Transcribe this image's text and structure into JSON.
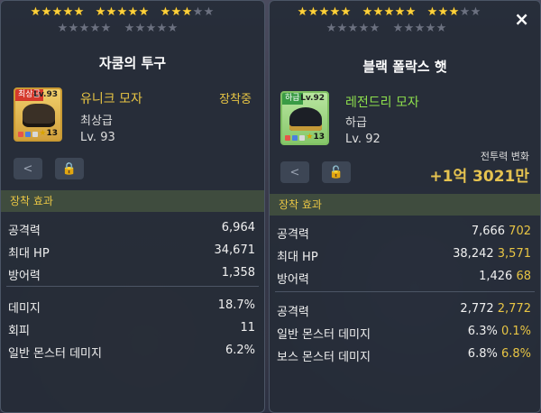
{
  "left": {
    "stars": {
      "on": 13,
      "total": 15
    },
    "title": "자쿰의 투구",
    "item": {
      "grade_tag": "최상급",
      "level_tag": "Lv.93",
      "star_count": "13",
      "name": "유니크 모자",
      "equipped": "장착중",
      "grade": "최상급",
      "level": "Lv. 93",
      "dot_colors": [
        "#e6554a",
        "#4a7fe0",
        "#d9d9d9"
      ]
    },
    "section_label": "장착 효과",
    "stats": [
      {
        "key": "공격력",
        "value": "6,964"
      },
      {
        "key": "최대 HP",
        "value": "34,671"
      },
      {
        "key": "방어력",
        "value": "1,358"
      }
    ],
    "stats2": [
      {
        "key": "데미지",
        "value": "18.7%"
      },
      {
        "key": "회피",
        "value": "11"
      },
      {
        "key": "일반 몬스터 데미지",
        "value": "6.2%"
      }
    ],
    "icons": {
      "share": "share-icon",
      "lock": "lock-icon"
    },
    "accent": "#e8c544"
  },
  "right": {
    "stars": {
      "on": 13,
      "total": 15
    },
    "title": "블랙 폴락스 햇",
    "close": "×",
    "item": {
      "grade_tag": "하급",
      "level_tag": "Lv.92",
      "star_count": "13",
      "name": "레전드리 모자",
      "grade": "하급",
      "level": "Lv. 92",
      "dot_colors": [
        "#e6554a",
        "#4a7fe0",
        "#d9d9d9"
      ]
    },
    "combat_power_label": "전투력 변화",
    "combat_power_value": "+1억 3021만",
    "section_label": "장착 효과",
    "stats": [
      {
        "key": "공격력",
        "value": "7,666",
        "diff": "702"
      },
      {
        "key": "최대 HP",
        "value": "38,242",
        "diff": "3,571"
      },
      {
        "key": "방어력",
        "value": "1,426",
        "diff": "68"
      }
    ],
    "stats2": [
      {
        "key": "공격력",
        "value": "2,772",
        "diff": "2,772"
      },
      {
        "key": "일반 몬스터 데미지",
        "value": "6.3%",
        "diff": "0.1%"
      },
      {
        "key": "보스 몬스터 데미지",
        "value": "6.8%",
        "diff": "6.8%"
      }
    ],
    "icons": {
      "share": "share-icon",
      "unlock": "unlock-icon"
    },
    "accent": "#e8c544",
    "legend_color": "#8ee04d"
  }
}
